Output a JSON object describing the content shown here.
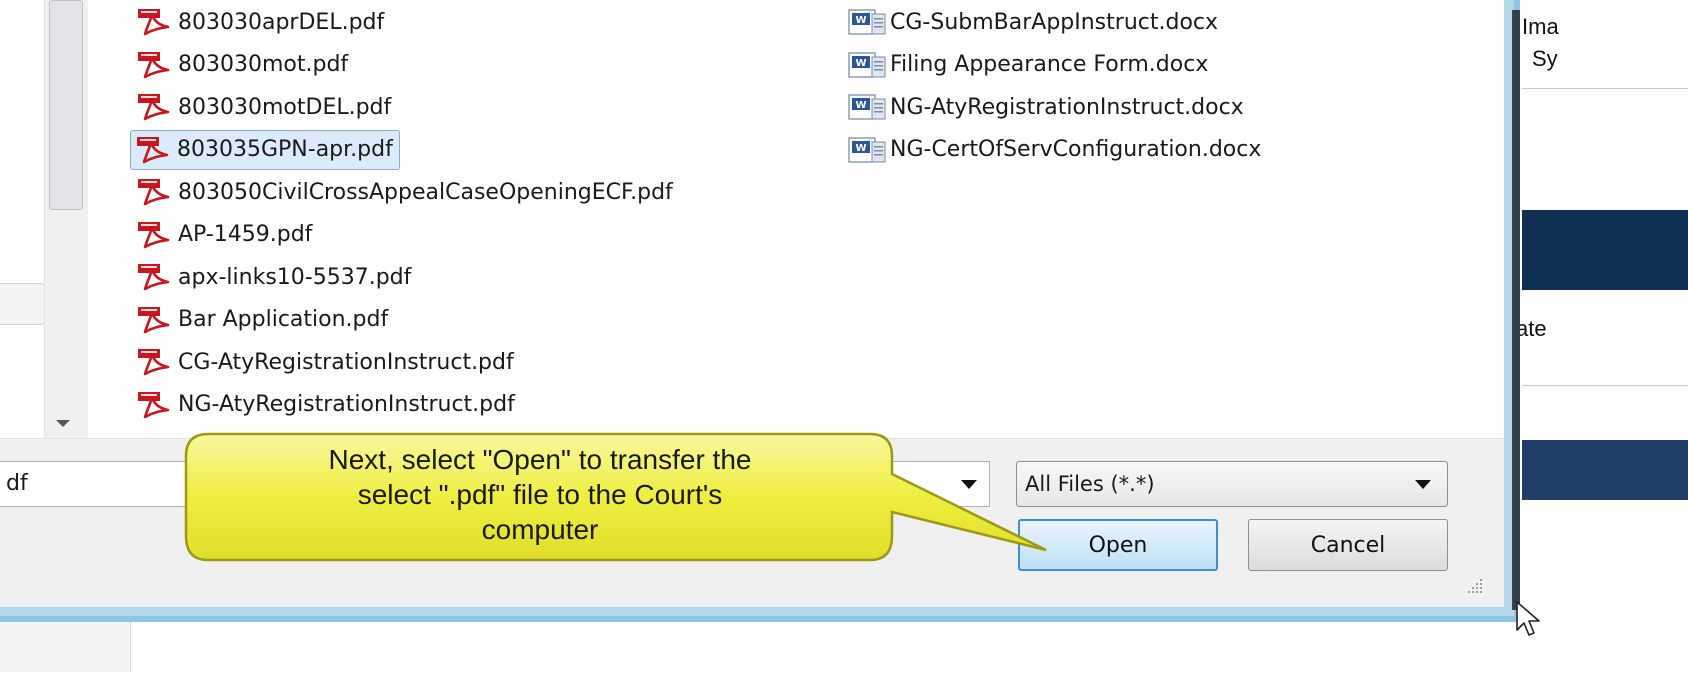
{
  "file_list": {
    "pdf_files": [
      {
        "name": "803030aprDEL.pdf",
        "selected": false
      },
      {
        "name": "803030mot.pdf",
        "selected": false
      },
      {
        "name": "803030motDEL.pdf",
        "selected": false
      },
      {
        "name": "803035GPN-apr.pdf",
        "selected": true
      },
      {
        "name": "803050CivilCrossAppealCaseOpeningECF.pdf",
        "selected": false
      },
      {
        "name": "AP-1459.pdf",
        "selected": false
      },
      {
        "name": "apx-links10-5537.pdf",
        "selected": false
      },
      {
        "name": "Bar Application.pdf",
        "selected": false
      },
      {
        "name": "CG-AtyRegistrationInstruct.pdf",
        "selected": false
      },
      {
        "name": "NG-AtyRegistrationInstruct.pdf",
        "selected": false
      }
    ],
    "docx_files": [
      {
        "name": "CG-SubmBarAppInstruct.docx"
      },
      {
        "name": "Filing Appearance Form.docx"
      },
      {
        "name": "NG-AtyRegistrationInstruct.docx"
      },
      {
        "name": "NG-CertOfServConfiguration.docx"
      }
    ]
  },
  "filename_input": {
    "value": "df"
  },
  "file_type": {
    "selected": "All Files (*.*)"
  },
  "buttons": {
    "open_label": "Open",
    "cancel_label": "Cancel"
  },
  "callout": {
    "lines": [
      "Next, select \"Open\" to transfer the",
      "select \".pdf\" file to the Court's",
      "computer"
    ]
  },
  "right_panel": {
    "text_1": "Ima",
    "text_2": "Sy",
    "text_3": "ate"
  },
  "colors": {
    "accent": "#3b8fd6",
    "selection": "#dcebfc",
    "callout_fill": "#f2f25a",
    "dialog_border": "#8fc6e1",
    "pdf_icon": "#c8171f",
    "word_icon": "#2b579a"
  },
  "icons": {
    "pdf": "acrobat-pdf-icon",
    "docx": "word-doc-icon"
  }
}
